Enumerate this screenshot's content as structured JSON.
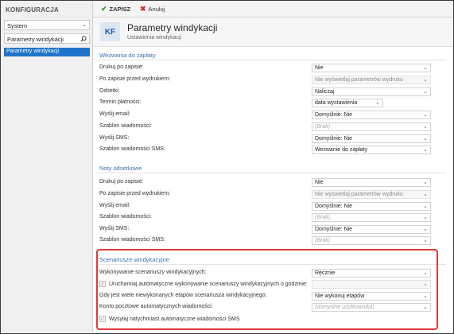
{
  "sidebar": {
    "title": "KONFIGURACJA",
    "select_value": "System",
    "search_value": "Parametry windykacji",
    "items": [
      {
        "label": "Parametry windykacji"
      }
    ]
  },
  "toolbar": {
    "save_label": "ZAPISZ",
    "cancel_label": "Anuluj"
  },
  "header": {
    "badge": "KF",
    "title": "Parametry windykacji",
    "subtitle": "Ustawienia windykacji"
  },
  "sections": {
    "wezwania": {
      "title": "Wezwania do zapłaty",
      "rows": [
        {
          "label": "Drukuj po zapisie:",
          "value": "Nie"
        },
        {
          "label": "Po zapisie przed wydrukiem:",
          "value": "Nie wyświetlaj parametrów wydruku"
        },
        {
          "label": "Odsetki:",
          "value": "Naliczaj"
        },
        {
          "label": "Termin płatności:",
          "value": "data wystawienia"
        },
        {
          "label": "Wyślij email:",
          "value": "Domyślnie: Nie"
        },
        {
          "label": "Szablon wiadomości:",
          "value": "(Brak)"
        },
        {
          "label": "Wyślij SMS:",
          "value": "Domyślnie: Nie"
        },
        {
          "label": "Szablon wiadomości SMS:",
          "value": "Wezwanie do zapłaty"
        }
      ]
    },
    "noty": {
      "title": "Noty odsetkowe",
      "rows": [
        {
          "label": "Drukuj po zapisie:",
          "value": "Nie"
        },
        {
          "label": "Po zapisie przed wydrukiem:",
          "value": "Nie wyświetlaj parametrów wydruku"
        },
        {
          "label": "Wyślij email:",
          "value": "Domyślnie: Nie"
        },
        {
          "label": "Szablon wiadomości:",
          "value": "(Brak)"
        },
        {
          "label": "Wyślij SMS:",
          "value": "Domyślnie: Nie"
        },
        {
          "label": "Szablon wiadomości SMS:",
          "value": "(Brak)"
        }
      ]
    },
    "scenariusze": {
      "title": "Scenariusze windykacyjne",
      "rows": [
        {
          "label": "Wykonywanie scenariuszy windykacyjnych:",
          "value": "Ręcznie"
        },
        {
          "label": "Uruchamiaj automatyczne wykonywanie scenariuszy windykacyjnych o godzinie:",
          "value": ""
        },
        {
          "label": "Gdy jest wiele niewykonanych etapów scenariusza windykacyjnego:",
          "value": "Nie wykonuj etapów"
        },
        {
          "label": "Konto pocztowe automatycznych wiadomości:",
          "value": "(domyślne użytkownika)"
        },
        {
          "label": "Wysyłaj natychmiast automatyczne wiadomości SMS",
          "value": ""
        }
      ]
    }
  },
  "colors": {
    "accent": "#1f74c9",
    "section_title": "#3b6fb3",
    "highlight": "#e03a3a",
    "save_icon": "#2e9a2e",
    "cancel_icon": "#d62b2b"
  }
}
